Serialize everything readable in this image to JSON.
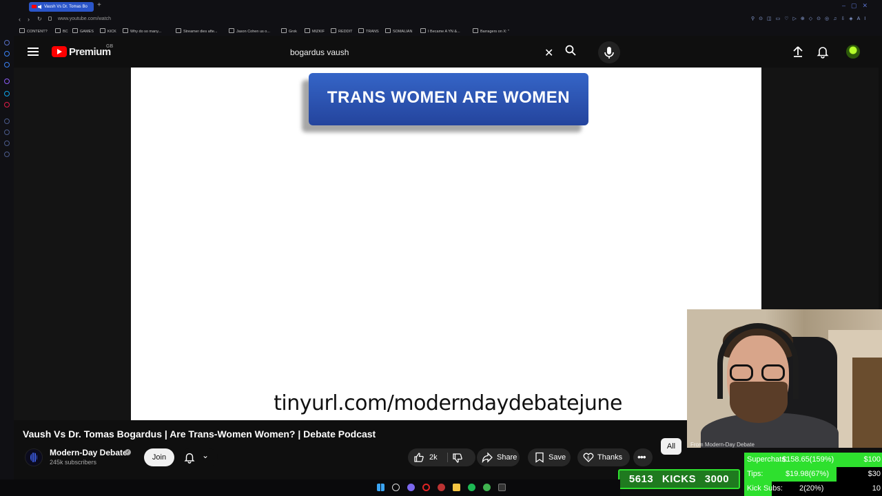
{
  "browser": {
    "tab_title": "Vaush Vs Dr. Tomas Bo",
    "url": "www.youtube.com/watch",
    "bookmarks": [
      "CONTENT?",
      "BC",
      "GAMES",
      "KICK",
      "Why do so many...",
      "Streamer dies afte...",
      "Jason Cohen us o...",
      "Grok",
      "MIZKIF",
      "REDDIT",
      "TRANS",
      "SOMALIAN",
      "I Became A YN &...",
      "Barragers on X: \""
    ]
  },
  "header": {
    "logo": "Premium",
    "region": "GB",
    "search_query": "bogardus vaush"
  },
  "video_frame": {
    "banner": "TRANS WOMEN ARE WOMEN",
    "link": "tinyurl.com/moderndaydebatejune"
  },
  "video": {
    "title": "Vaush Vs Dr. Tomas Bogardus | Are Trans-Women Women? | Debate Podcast",
    "channel": "Modern-Day Debate",
    "subscribers": "245k subscribers",
    "join_label": "Join",
    "likes": "2k",
    "share_label": "Share",
    "save_label": "Save",
    "thanks_label": "Thanks",
    "filter_chip": "All"
  },
  "overlay": {
    "cam_caption": "From Modern-Day Debate",
    "kicks_current": "5613",
    "kicks_label": "KICKS",
    "kicks_goal": "3000",
    "rows": [
      {
        "label": "Superchats:",
        "amount": "$158.65(159%)",
        "goal": "$100",
        "progress": 1.0
      },
      {
        "label": "Tips:",
        "amount": "$19.98(67%)",
        "goal": "$30",
        "progress": 0.67
      },
      {
        "label": "Kick Subs:",
        "amount": "2(20%)",
        "goal": "10",
        "progress": 0.2
      }
    ]
  },
  "colors": {
    "yt_red": "#ff0000",
    "overlay_green": "#2ee02e",
    "banner_blue": "#2f5bbf"
  }
}
